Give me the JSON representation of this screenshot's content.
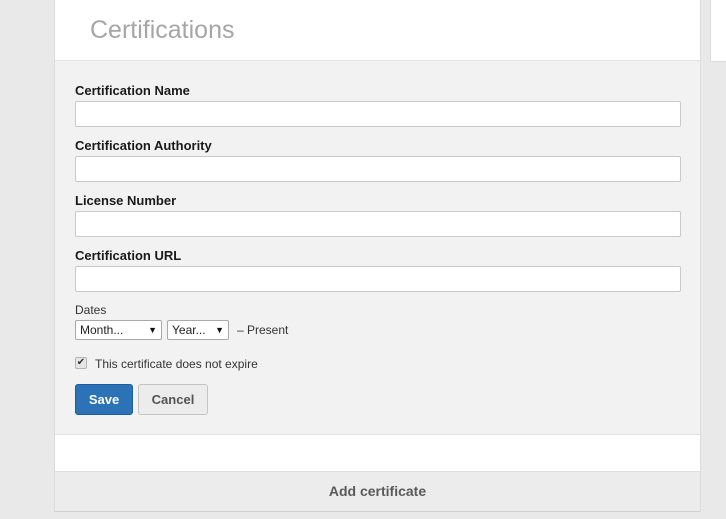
{
  "header": {
    "title": "Certifications"
  },
  "form": {
    "fields": [
      {
        "label": "Certification Name",
        "value": "",
        "placeholder": ""
      },
      {
        "label": "Certification Authority",
        "value": "",
        "placeholder": ""
      },
      {
        "label": "License Number",
        "value": "",
        "placeholder": ""
      },
      {
        "label": "Certification URL",
        "value": "",
        "placeholder": ""
      }
    ],
    "dates": {
      "label": "Dates",
      "month_select": "Month...",
      "year_select": "Year...",
      "present_text": "– Present"
    },
    "no_expire": {
      "checked": true,
      "label": "This certificate does not expire"
    },
    "buttons": {
      "save": "Save",
      "cancel": "Cancel"
    }
  },
  "footer": {
    "add_label": "Add certificate"
  },
  "colors": {
    "accent": "#2b73b6",
    "background": "#e9e9e9",
    "form_background": "#f2f2f2"
  },
  "icons": {
    "dropdown": "triangle-down-icon",
    "checkbox": "checkmark-icon"
  }
}
